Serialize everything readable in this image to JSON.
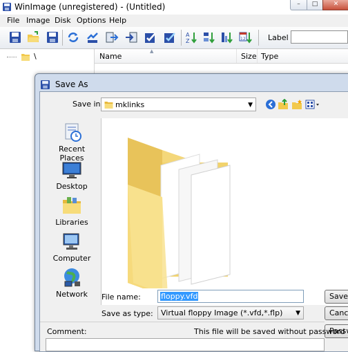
{
  "window": {
    "title": "WinImage (unregistered) - (Untitled)",
    "controls": {
      "minimize": "–",
      "maximize": "□",
      "close": "✕"
    }
  },
  "menu": [
    "File",
    "Image",
    "Disk",
    "Options",
    "Help"
  ],
  "toolbar": {
    "icons": [
      "save-disk-icon",
      "open-folder-icon",
      "save-icon",
      "refresh-icon",
      "move-icon",
      "extract-icon",
      "inject-icon",
      "check-icon",
      "check2-icon",
      "sort-az-icon",
      "sort-down-icon",
      "sort-size-icon",
      "sort-date-icon"
    ],
    "label_text": "Label :",
    "label_value": ""
  },
  "tree": {
    "root": "\\"
  },
  "list": {
    "columns": [
      "Name",
      "Size",
      "Type"
    ]
  },
  "dialog": {
    "title": "Save As",
    "save_in_label": "Save in:",
    "save_in_value": "mklinks",
    "places": [
      "Recent Places",
      "Desktop",
      "Libraries",
      "Computer",
      "Network"
    ],
    "file_name_label": "File name:",
    "file_name_value": "floppy.vfd",
    "save_type_label": "Save as type:",
    "save_type_value": "Virtual floppy Image (*.vfd,*.flp)",
    "save_button": "Save",
    "cancel_button": "Cancel",
    "password_button": "Password",
    "comment_label": "Comment:",
    "no_password_msg": "This file will be saved without password",
    "comment_value": ""
  },
  "colors": {
    "accent": "#3399ff",
    "dialog_frame": "#cfdbec",
    "folder": "#f5d77a"
  }
}
